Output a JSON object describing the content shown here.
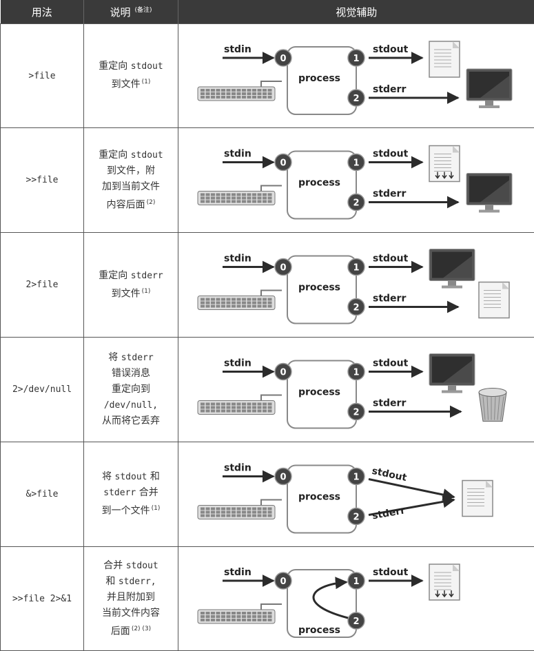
{
  "header": {
    "usage": "用法",
    "desc": "说明",
    "desc_note": "(备注)",
    "visual": "视觉辅助"
  },
  "rows": [
    {
      "usage": "&gt;file",
      "usage_text": ">file",
      "desc": [
        {
          "parts": [
            "重定向 ",
            {
              "mono": "stdout"
            }
          ]
        },
        {
          "parts": [
            "到文件"
          ],
          "sup": "(1)"
        }
      ],
      "visual": {
        "stdin": "stdin",
        "stdout": "stdout",
        "stderr": "stderr",
        "process": "process",
        "p0": "0",
        "p1": "1",
        "p2": "2"
      }
    },
    {
      "usage_text": ">>file",
      "desc": [
        {
          "parts": [
            "重定向 ",
            {
              "mono": "stdout"
            }
          ]
        },
        {
          "parts": [
            "到文件，附"
          ]
        },
        {
          "parts": [
            "加到当前文件"
          ]
        },
        {
          "parts": [
            "内容后面"
          ],
          "sup": "(2)"
        }
      ],
      "visual": {
        "stdin": "stdin",
        "stdout": "stdout",
        "stderr": "stderr",
        "process": "process",
        "p0": "0",
        "p1": "1",
        "p2": "2"
      }
    },
    {
      "usage_text": "2>file",
      "desc": [
        {
          "parts": [
            "重定向 ",
            {
              "mono": "stderr"
            }
          ]
        },
        {
          "parts": [
            "到文件"
          ],
          "sup": "(1)"
        }
      ],
      "visual": {
        "stdin": "stdin",
        "stdout": "stdout",
        "stderr": "stderr",
        "process": "process",
        "p0": "0",
        "p1": "1",
        "p2": "2"
      }
    },
    {
      "usage_text": "2>/dev/null",
      "desc": [
        {
          "parts": [
            "将 ",
            {
              "mono": "stderr"
            }
          ]
        },
        {
          "parts": [
            "错误消息"
          ]
        },
        {
          "parts": [
            "重定向到"
          ]
        },
        {
          "parts": [
            {
              "mono": "/dev/null,"
            }
          ]
        },
        {
          "parts": [
            "从而将它丢弃"
          ]
        }
      ],
      "visual": {
        "stdin": "stdin",
        "stdout": "stdout",
        "stderr": "stderr",
        "process": "process",
        "p0": "0",
        "p1": "1",
        "p2": "2"
      }
    },
    {
      "usage_text": "&>file",
      "desc": [
        {
          "parts": [
            "将 ",
            {
              "mono": "stdout"
            },
            " 和"
          ]
        },
        {
          "parts": [
            {
              "mono": "stderr"
            },
            " 合并"
          ]
        },
        {
          "parts": [
            "到一个文件"
          ],
          "sup": "(1)"
        }
      ],
      "visual": {
        "stdin": "stdin",
        "stdout": "stdout",
        "stderr": "stderr",
        "process": "process",
        "p0": "0",
        "p1": "1",
        "p2": "2"
      }
    },
    {
      "usage_text": ">>file  2>&1",
      "desc": [
        {
          "parts": [
            "合并 ",
            {
              "mono": "stdout"
            }
          ]
        },
        {
          "parts": [
            "和 ",
            {
              "mono": "stderr,"
            }
          ]
        },
        {
          "parts": [
            "并且附加到"
          ]
        },
        {
          "parts": [
            "当前文件内容"
          ]
        },
        {
          "parts": [
            "后面"
          ],
          "sup": "(2) (3)"
        }
      ],
      "visual": {
        "stdin": "stdin",
        "stdout": "stdout",
        "process": "process",
        "p0": "0",
        "p1": "1",
        "p2": "2"
      }
    }
  ],
  "colors": {
    "header_bg": "#3a3a3a",
    "circle": "#444444",
    "arrow": "#2b2b2b"
  }
}
